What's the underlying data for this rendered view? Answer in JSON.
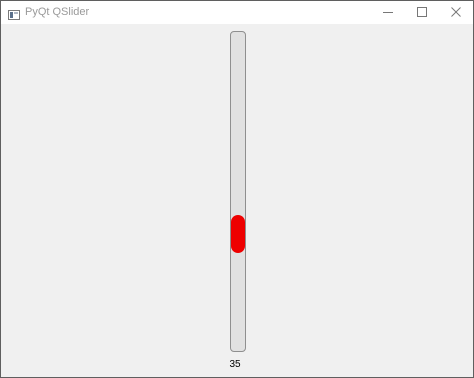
{
  "window": {
    "title": "PyQt QSlider",
    "icon": "app-icon",
    "controls": [
      "minimize-icon",
      "maximize-icon",
      "close-icon"
    ]
  },
  "slider": {
    "orientation": "vertical",
    "value": 35,
    "min": 0,
    "max": 100,
    "handle_color": "#ee0000"
  },
  "value_label": "35"
}
